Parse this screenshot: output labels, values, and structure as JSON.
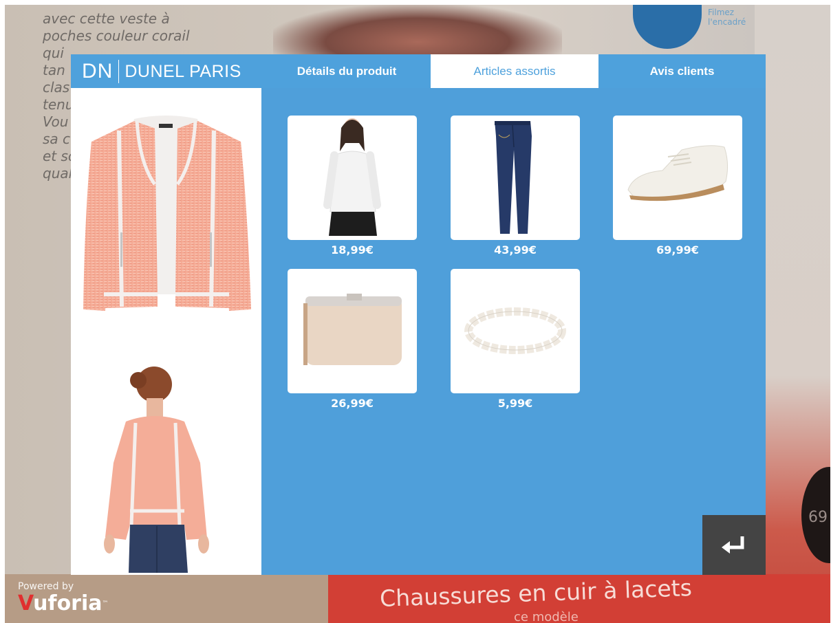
{
  "background": {
    "text_lines": [
      "avec cette veste à",
      "poches couleur corail",
      "qui",
      "tan",
      "clas",
      "tenu",
      "Vou",
      "sa c",
      "et so",
      "qualit"
    ],
    "circle_text": [
      "Filmez",
      "l'encadré"
    ],
    "right_number": "69",
    "heading": "Chaussures en cuir à lacets",
    "subheading": "ce modèle",
    "powered_by": "Powered by",
    "vuforia": "Vuforia"
  },
  "brand": {
    "mark": "DN",
    "name": "DUNEL PARIS"
  },
  "tabs": {
    "details": "Détails du produit",
    "assorted": "Articles assortis",
    "reviews": "Avis clients",
    "active": "assorted"
  },
  "products": [
    {
      "price": "18,99€",
      "item": "white long-sleeve top"
    },
    {
      "price": "43,99€",
      "item": "dark blue jeans"
    },
    {
      "price": "69,99€",
      "item": "white lace-up shoes"
    },
    {
      "price": "26,99€",
      "item": "beige clutch bag"
    },
    {
      "price": "5,99€",
      "item": "pearl bracelet"
    }
  ],
  "colors": {
    "accent": "#4ea1dc",
    "jacket": "#f4b19c",
    "return_button": "#444444"
  },
  "icons": {
    "return": "return-arrow-icon"
  }
}
